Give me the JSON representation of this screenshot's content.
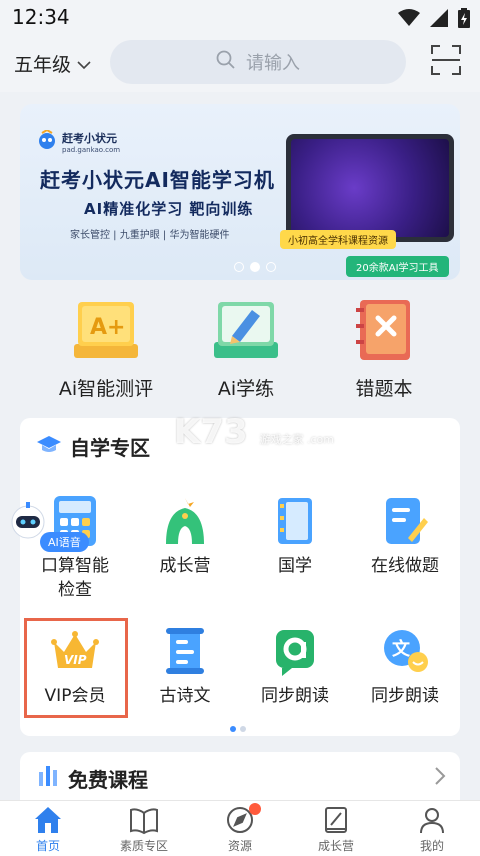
{
  "status": {
    "time": "12:34"
  },
  "header": {
    "grade": "五年级",
    "search_placeholder": "请输入"
  },
  "banner": {
    "brand": "赶考小状元",
    "site": "pad.gankao.com",
    "title": "赶考小状元AI智能学习机",
    "subtitle": "AI精准化学习 靶向训练",
    "features": "家长管控 | 九重护眼 | 华为智能硬件",
    "tag1": "小初高全学科课程资源",
    "tag2": "20余款AI学习工具"
  },
  "quick": [
    {
      "label": "Ai智能测评",
      "icon": "ai-test-icon"
    },
    {
      "label": "Ai学练",
      "icon": "ai-practice-icon"
    },
    {
      "label": "错题本",
      "icon": "wrong-book-icon"
    }
  ],
  "self_study": {
    "title": "自学专区",
    "items": [
      {
        "label": "口算智能检查",
        "label_line1": "口算智能",
        "label_line2": "检查",
        "icon": "calculator-icon"
      },
      {
        "label": "成长营",
        "icon": "growth-camp-icon"
      },
      {
        "label": "国学",
        "icon": "classics-book-icon"
      },
      {
        "label": "在线做题",
        "icon": "online-exercise-icon"
      },
      {
        "label": "VIP会员",
        "icon": "vip-crown-icon"
      },
      {
        "label": "古诗文",
        "icon": "ancient-poetry-icon"
      },
      {
        "label": "同步朗读",
        "icon": "sync-reading-icon"
      },
      {
        "label": "同步朗读",
        "icon": "sync-reading-chat-icon"
      }
    ]
  },
  "ai_voice": {
    "label": "AI语音"
  },
  "watermark": {
    "text": "K73",
    "sub": "游戏之家 .com"
  },
  "free_courses": {
    "title": "免费课程"
  },
  "tabs": [
    {
      "label": "首页",
      "icon": "home-icon",
      "active": true
    },
    {
      "label": "素质专区",
      "icon": "open-book-icon",
      "active": false
    },
    {
      "label": "资源",
      "icon": "compass-icon",
      "active": false
    },
    {
      "label": "成长营",
      "icon": "notebook-pen-icon",
      "active": false
    },
    {
      "label": "我的",
      "icon": "user-icon",
      "active": false
    }
  ],
  "colors": {
    "accent": "#2f80ed",
    "vip_border": "#e8664a",
    "banner_bg": "#e3edf8"
  }
}
